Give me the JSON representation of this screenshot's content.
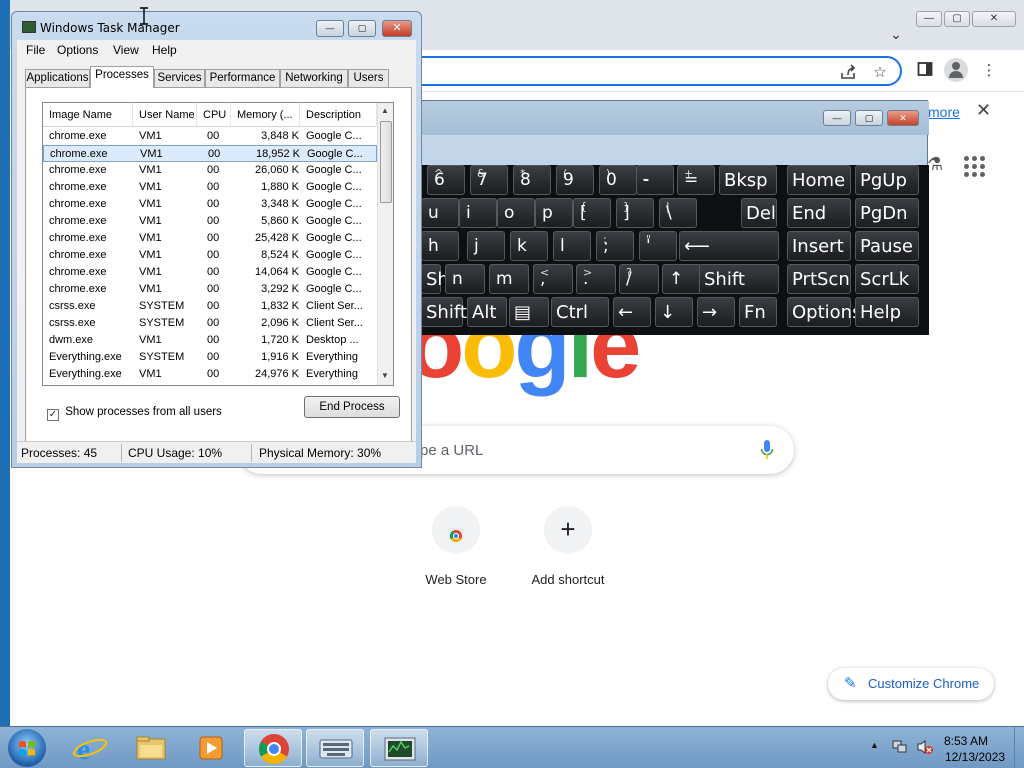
{
  "chrome": {
    "title_buttons": {
      "minimize": "—",
      "maximize": "▢",
      "close": "✕"
    },
    "tab_search_icon": "chevron-down",
    "omnibox_icons": [
      "share-icon",
      "star-icon"
    ],
    "toolbar_icons": [
      "side-panel-icon",
      "profile-avatar",
      "menu-kebab-icon"
    ],
    "infobar": {
      "learn_more": "more",
      "close": "✕"
    },
    "logo_letters": [
      "o",
      "o",
      "g",
      "l",
      "e"
    ],
    "logo_colors": [
      "#ea4335",
      "#fbbc05",
      "#4285f4",
      "#34a853",
      "#ea4335"
    ],
    "search": {
      "placeholder": "pe a URL"
    },
    "shortcuts": [
      {
        "label": "Web Store",
        "icon": "chrome-web-store-icon"
      },
      {
        "label": "Add shortcut",
        "icon": "plus-icon",
        "symbol": "+"
      }
    ],
    "customize": {
      "label": "Customize Chrome",
      "icon": "pencil-icon"
    }
  },
  "osk": {
    "buttons": {
      "minimize": "—",
      "maximize": "▢",
      "close": "✕"
    },
    "row1": [
      {
        "sub": "^",
        "main": "6"
      },
      {
        "sub": "&",
        "main": "7"
      },
      {
        "sub": "*",
        "main": "8"
      },
      {
        "sub": "(",
        "main": "9"
      },
      {
        "sub": ")",
        "main": "0"
      },
      {
        "sub": "_",
        "main": "-"
      },
      {
        "sub": "+",
        "main": "="
      }
    ],
    "row1_words": [
      "Bksp",
      "Home",
      "PgUp"
    ],
    "row2": [
      {
        "sub": "",
        "main": "u"
      },
      {
        "sub": "",
        "main": "i"
      },
      {
        "sub": "",
        "main": "o"
      },
      {
        "sub": "",
        "main": "p"
      },
      {
        "sub": "{",
        "main": "["
      },
      {
        "sub": "}",
        "main": "]"
      },
      {
        "sub": "|",
        "main": "\\"
      }
    ],
    "row2_words": [
      "Del",
      "End",
      "PgDn"
    ],
    "row3": [
      {
        "sub": "",
        "main": "h"
      },
      {
        "sub": "",
        "main": "j"
      },
      {
        "sub": "",
        "main": "k"
      },
      {
        "sub": "",
        "main": "l"
      },
      {
        "sub": ":",
        "main": ";"
      },
      {
        "sub": "\"",
        "main": "'"
      }
    ],
    "row3_enter": "⟵",
    "row3_words": [
      "Insert",
      "Pause"
    ],
    "row4": [
      {
        "sub": "",
        "main": "n"
      },
      {
        "sub": "",
        "main": "m"
      },
      {
        "sub": "<",
        "main": ","
      },
      {
        "sub": ">",
        "main": "."
      },
      {
        "sub": "?",
        "main": "/"
      },
      {
        "sub": "",
        "main": "↑"
      }
    ],
    "row4_words": [
      "Shift",
      "PrtScn",
      "ScrLk"
    ],
    "row5": [
      "Alt",
      "▤",
      "Ctrl",
      "←",
      "↓",
      "→",
      "Fn",
      "Options",
      "Help"
    ]
  },
  "taskmgr": {
    "title": "Windows Task Manager",
    "buttons": {
      "minimize": "—",
      "maximize": "▢",
      "close": "✕"
    },
    "menu": [
      "File",
      "Options",
      "View",
      "Help"
    ],
    "tabs": [
      "Applications",
      "Processes",
      "Services",
      "Performance",
      "Networking",
      "Users"
    ],
    "active_tab": "Processes",
    "columns": [
      "Image Name",
      "User Name",
      "CPU",
      "Memory (...",
      "Description"
    ],
    "sort_indicator": "ˆ",
    "rows": [
      [
        "chrome.exe",
        "VM1",
        "00",
        "3,848 K",
        "Google C..."
      ],
      [
        "chrome.exe",
        "VM1",
        "00",
        "18,952 K",
        "Google C..."
      ],
      [
        "chrome.exe",
        "VM1",
        "00",
        "26,060 K",
        "Google C..."
      ],
      [
        "chrome.exe",
        "VM1",
        "00",
        "1,880 K",
        "Google C..."
      ],
      [
        "chrome.exe",
        "VM1",
        "00",
        "3,348 K",
        "Google C..."
      ],
      [
        "chrome.exe",
        "VM1",
        "00",
        "5,860 K",
        "Google C..."
      ],
      [
        "chrome.exe",
        "VM1",
        "00",
        "25,428 K",
        "Google C..."
      ],
      [
        "chrome.exe",
        "VM1",
        "00",
        "8,524 K",
        "Google C..."
      ],
      [
        "chrome.exe",
        "VM1",
        "00",
        "14,064 K",
        "Google C..."
      ],
      [
        "chrome.exe",
        "VM1",
        "00",
        "3,292 K",
        "Google C..."
      ],
      [
        "csrss.exe",
        "SYSTEM",
        "00",
        "1,832 K",
        "Client Ser..."
      ],
      [
        "csrss.exe",
        "SYSTEM",
        "00",
        "2,096 K",
        "Client Ser..."
      ],
      [
        "dwm.exe",
        "VM1",
        "00",
        "1,720 K",
        "Desktop ..."
      ],
      [
        "Everything.exe",
        "SYSTEM",
        "00",
        "1,916 K",
        "Everything"
      ],
      [
        "Everything.exe",
        "VM1",
        "00",
        "24,976 K",
        "Everything"
      ]
    ],
    "selected_row": 1,
    "show_all_checked": "✓",
    "show_all_label": "Show processes from all users",
    "end_process": "End Process",
    "status": {
      "processes": "Processes: 45",
      "cpu": "CPU Usage: 10%",
      "memory": "Physical Memory: 30%"
    }
  },
  "taskbar": {
    "apps": [
      "internet-explorer-icon",
      "file-explorer-icon",
      "media-player-icon",
      "chrome-icon",
      "on-screen-keyboard-icon",
      "task-manager-icon"
    ],
    "tray_icons": [
      "show-hidden-icons-arrow",
      "network-icon",
      "volume-muted-icon"
    ],
    "time": "8:53 AM",
    "date": "12/13/2023"
  }
}
